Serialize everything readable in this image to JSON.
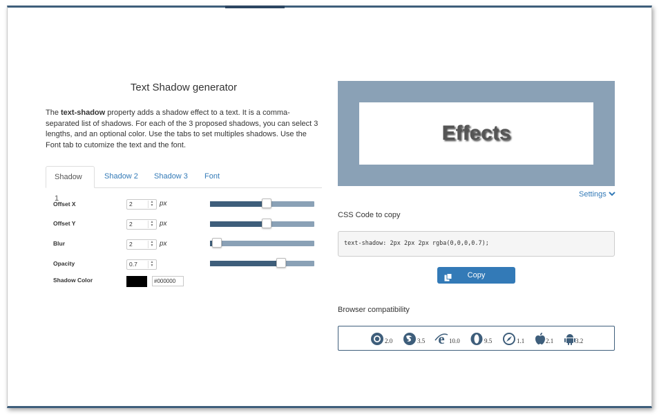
{
  "page": {
    "title": "Text Shadow generator",
    "description": {
      "before": "The ",
      "keyword": "text-shadow",
      "after": " property adds a shadow effect to a text. It is a comma-separated list of shadows. For each of the 3 proposed shadows, you can select 3 lengths, and an optional color. Use the tabs to set multiples shadows. Use the Font tab to cutomize the text and the font."
    }
  },
  "tabs": [
    "Shadow 1",
    "Shadow 2",
    "Shadow 3",
    "Font"
  ],
  "controls": {
    "offset_x": {
      "label": "Offset X",
      "value": "2",
      "unit": "px",
      "slider_fraction": 0.55
    },
    "offset_y": {
      "label": "Offset Y",
      "value": "2",
      "unit": "px",
      "slider_fraction": 0.55
    },
    "blur": {
      "label": "Blur",
      "value": "2",
      "unit": "px",
      "slider_fraction": 0.02
    },
    "opacity": {
      "label": "Opacity",
      "value": "0.7",
      "slider_fraction": 0.7
    },
    "shadow_color": {
      "label": "Shadow Color",
      "value": "#000000",
      "swatch_color": "#000000"
    }
  },
  "preview": {
    "text": "Effects",
    "bg_color": "#8aa1b6"
  },
  "settings_label": "Settings",
  "css": {
    "label": "CSS Code to copy",
    "code": "text-shadow: 2px 2px 2px rgba(0,0,0,0.7);",
    "copy_label": "Copy"
  },
  "compat": {
    "label": "Browser compatibility",
    "browsers": [
      {
        "icon": "chrome-icon",
        "version": "2.0"
      },
      {
        "icon": "firefox-icon",
        "version": "3.5"
      },
      {
        "icon": "internet-explorer-icon",
        "version": "10.0"
      },
      {
        "icon": "opera-icon",
        "version": "9.5"
      },
      {
        "icon": "safari-icon",
        "version": "1.1"
      },
      {
        "icon": "apple-icon",
        "version": "2.1"
      },
      {
        "icon": "android-icon",
        "version": "3.2"
      }
    ]
  },
  "colors": {
    "accent": "#337ab7",
    "slider_fill": "#3e5e7b",
    "slider_track": "#8aa1b6"
  }
}
